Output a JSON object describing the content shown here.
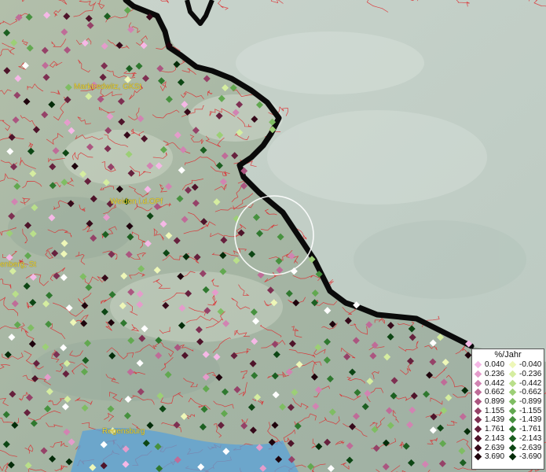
{
  "map": {
    "places": [
      {
        "id": "marktredwitz",
        "label": "Marktredwitz, GKSt"
      },
      {
        "id": "weiden",
        "label": "Weiden i.d.OPf"
      },
      {
        "id": "amberg",
        "label": "enberg, St"
      },
      {
        "id": "regensburg",
        "label": "Regensburg"
      }
    ],
    "legend": {
      "title": "%/Jahr",
      "positive": [
        {
          "value": "0.040",
          "color": "#f5b8e6"
        },
        {
          "value": "0.236",
          "color": "#e49ccb"
        },
        {
          "value": "0.442",
          "color": "#d184b2"
        },
        {
          "value": "0.662",
          "color": "#bf6c98"
        },
        {
          "value": "0.899",
          "color": "#ab5680"
        },
        {
          "value": "1.155",
          "color": "#954268"
        },
        {
          "value": "1.439",
          "color": "#7e3052"
        },
        {
          "value": "1.761",
          "color": "#66213d"
        },
        {
          "value": "2.143",
          "color": "#4e142a"
        },
        {
          "value": "2.639",
          "color": "#360a1a"
        },
        {
          "value": "3.690",
          "color": "#1e030c"
        }
      ],
      "negative": [
        {
          "value": "-0.040",
          "color": "#eef7b8"
        },
        {
          "value": "-0.236",
          "color": "#d5eda0"
        },
        {
          "value": "-0.442",
          "color": "#b9df8a"
        },
        {
          "value": "-0.662",
          "color": "#9ccf76"
        },
        {
          "value": "-0.899",
          "color": "#7fbd63"
        },
        {
          "value": "-1.155",
          "color": "#62a850"
        },
        {
          "value": "-1.439",
          "color": "#47913f"
        },
        {
          "value": "-1.761",
          "color": "#2f782f"
        },
        {
          "value": "-2.143",
          "color": "#1c5f21"
        },
        {
          "value": "-2.639",
          "color": "#0d4614"
        },
        {
          "value": "-3.690",
          "color": "#042c09"
        }
      ]
    },
    "colors": {
      "terrain_de": "#a9b8a6",
      "terrain_cz": "#c3cfc6",
      "border": "#0a0a0a",
      "municipal_lines": "#e0262a",
      "river": "#3f8fcf",
      "highlight_circle": "#ffffff",
      "label_text": "#e8d23a"
    }
  }
}
